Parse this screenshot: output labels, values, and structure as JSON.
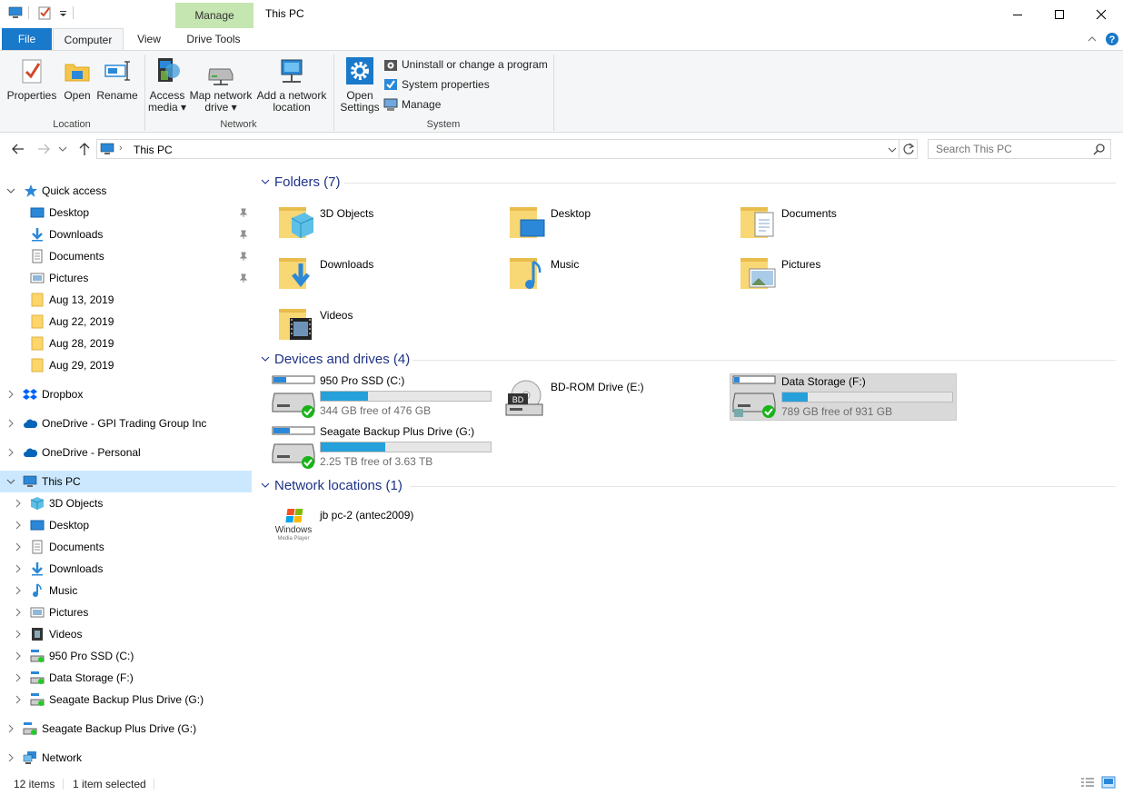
{
  "titlebar": {
    "title": "This PC",
    "context_tab": "Manage",
    "colors": {
      "context_tab_bg": "#c5e6b1",
      "file_tab_bg": "#1979ca",
      "selection": "#cce8ff"
    }
  },
  "ribbon": {
    "tabs": {
      "file": "File",
      "computer": "Computer",
      "view": "View",
      "drive_tools": "Drive Tools"
    },
    "location": {
      "label": "Location",
      "properties": "Properties",
      "open": "Open",
      "rename": "Rename"
    },
    "network": {
      "label": "Network",
      "access_media_1": "Access",
      "access_media_2": "media",
      "map_drive_1": "Map network",
      "map_drive_2": "drive",
      "add_location_1": "Add a network",
      "add_location_2": "location"
    },
    "system": {
      "label": "System",
      "open_settings_1": "Open",
      "open_settings_2": "Settings",
      "uninstall": "Uninstall or change a program",
      "system_properties": "System properties",
      "manage": "Manage"
    }
  },
  "address": {
    "path": "This PC",
    "search_placeholder": "Search This PC"
  },
  "nav": {
    "quick_access": "Quick access",
    "quick_items": [
      "Desktop",
      "Downloads",
      "Documents",
      "Pictures",
      "Aug 13, 2019",
      "Aug 22, 2019",
      "Aug 28, 2019",
      "Aug 29, 2019"
    ],
    "dropbox": "Dropbox",
    "onedrive_business": "OneDrive - GPI Trading Group Inc",
    "onedrive_personal": "OneDrive - Personal",
    "this_pc": "This PC",
    "pc_items": [
      "3D Objects",
      "Desktop",
      "Documents",
      "Downloads",
      "Music",
      "Pictures",
      "Videos",
      "950 Pro SSD (C:)",
      "Data Storage (F:)",
      "Seagate Backup Plus Drive (G:)"
    ],
    "seagate_root": "Seagate Backup Plus Drive (G:)",
    "network": "Network"
  },
  "content": {
    "folders_header": "Folders (7)",
    "folders": [
      "3D Objects",
      "Desktop",
      "Documents",
      "Downloads",
      "Music",
      "Pictures",
      "Videos"
    ],
    "drives_header": "Devices and drives (4)",
    "drives": [
      {
        "name": "950 Pro SSD (C:)",
        "free": "344 GB free of 476 GB",
        "used_fraction": 0.28
      },
      {
        "name": "BD-ROM Drive (E:)"
      },
      {
        "name": "Data Storage (F:)",
        "free": "789 GB free of 931 GB",
        "used_fraction": 0.15
      },
      {
        "name": "Seagate Backup Plus Drive (G:)",
        "free": "2.25 TB free of 3.63 TB",
        "used_fraction": 0.38
      }
    ],
    "network_header": "Network locations (1)",
    "network_location": "jb pc-2 (antec2009)",
    "wmp_logo": "Windows",
    "wmp_logo_sub": "Media Player",
    "bd_label": "BD"
  },
  "status": {
    "items": "12 items",
    "selected": "1 item selected"
  }
}
